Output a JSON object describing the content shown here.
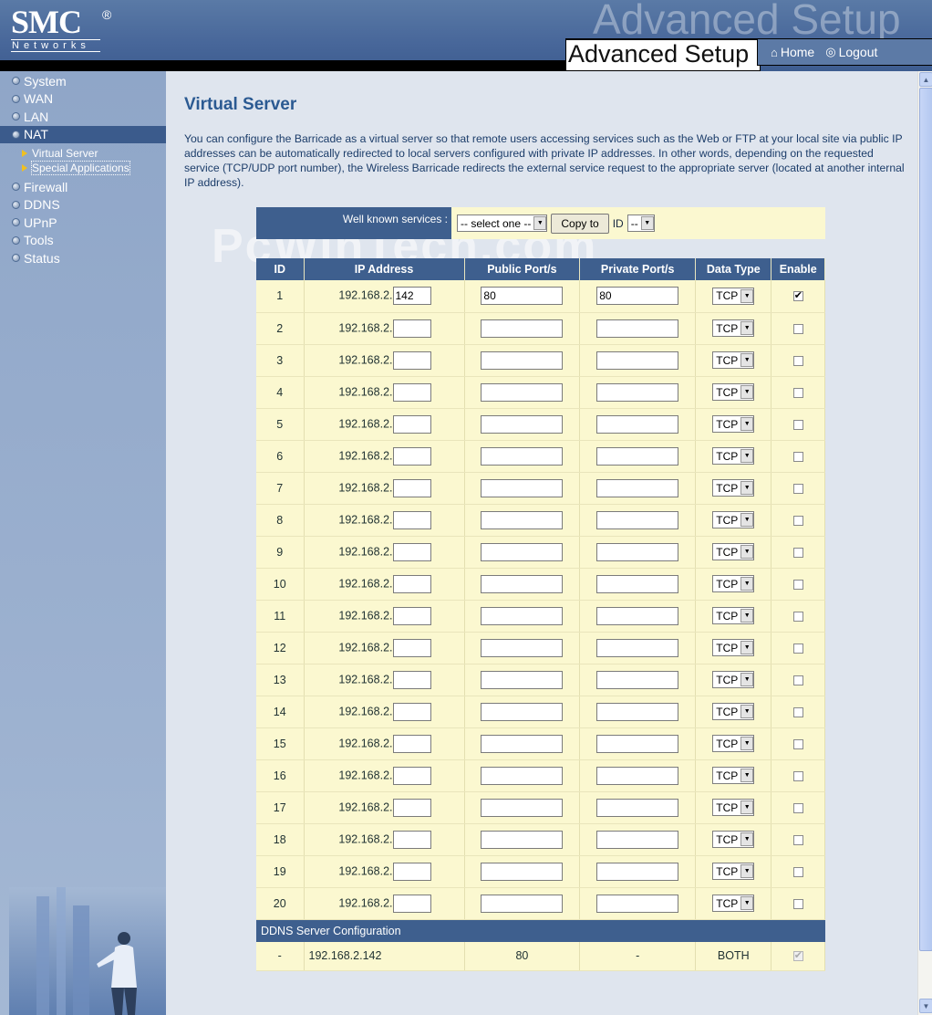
{
  "header": {
    "logo_text": "SMC",
    "logo_reg": "®",
    "logo_sub": "Networks",
    "ghost_title": "Advanced Setup",
    "title": "Advanced Setup",
    "home_label": "Home",
    "logout_label": "Logout"
  },
  "sidebar": {
    "items": [
      {
        "label": "System"
      },
      {
        "label": "WAN"
      },
      {
        "label": "LAN"
      },
      {
        "label": "NAT"
      },
      {
        "label": "Firewall"
      },
      {
        "label": "DDNS"
      },
      {
        "label": "UPnP"
      },
      {
        "label": "Tools"
      },
      {
        "label": "Status"
      }
    ],
    "sub_items": [
      {
        "label": "Virtual Server"
      },
      {
        "label": "Special Applications"
      }
    ]
  },
  "main": {
    "title": "Virtual Server",
    "intro": "You can configure the Barricade as a virtual server so that remote users accessing services such as the Web or FTP at your local site via public IP addresses can be automatically redirected to local servers configured with private IP addresses. In other words, depending on the requested service (TCP/UDP port number), the Wireless Barricade redirects the external service request to the appropriate server (located at another internal IP address).",
    "watermark": "PcWinTech.com",
    "well_known_label": "Well known services :",
    "service_select": "-- select one --",
    "copy_button": "Copy to",
    "id_label": "ID",
    "id_select": "--",
    "columns": [
      "ID",
      "IP Address",
      "Public Port/s",
      "Private Port/s",
      "Data Type",
      "Enable"
    ],
    "ip_prefix": "192.168.2.",
    "rows": [
      {
        "id": "1",
        "ip": "142",
        "public": "80",
        "private": "80",
        "type": "TCP",
        "enabled": true
      },
      {
        "id": "2",
        "ip": "",
        "public": "",
        "private": "",
        "type": "TCP",
        "enabled": false
      },
      {
        "id": "3",
        "ip": "",
        "public": "",
        "private": "",
        "type": "TCP",
        "enabled": false
      },
      {
        "id": "4",
        "ip": "",
        "public": "",
        "private": "",
        "type": "TCP",
        "enabled": false
      },
      {
        "id": "5",
        "ip": "",
        "public": "",
        "private": "",
        "type": "TCP",
        "enabled": false
      },
      {
        "id": "6",
        "ip": "",
        "public": "",
        "private": "",
        "type": "TCP",
        "enabled": false
      },
      {
        "id": "7",
        "ip": "",
        "public": "",
        "private": "",
        "type": "TCP",
        "enabled": false
      },
      {
        "id": "8",
        "ip": "",
        "public": "",
        "private": "",
        "type": "TCP",
        "enabled": false
      },
      {
        "id": "9",
        "ip": "",
        "public": "",
        "private": "",
        "type": "TCP",
        "enabled": false
      },
      {
        "id": "10",
        "ip": "",
        "public": "",
        "private": "",
        "type": "TCP",
        "enabled": false
      },
      {
        "id": "11",
        "ip": "",
        "public": "",
        "private": "",
        "type": "TCP",
        "enabled": false
      },
      {
        "id": "12",
        "ip": "",
        "public": "",
        "private": "",
        "type": "TCP",
        "enabled": false
      },
      {
        "id": "13",
        "ip": "",
        "public": "",
        "private": "",
        "type": "TCP",
        "enabled": false
      },
      {
        "id": "14",
        "ip": "",
        "public": "",
        "private": "",
        "type": "TCP",
        "enabled": false
      },
      {
        "id": "15",
        "ip": "",
        "public": "",
        "private": "",
        "type": "TCP",
        "enabled": false
      },
      {
        "id": "16",
        "ip": "",
        "public": "",
        "private": "",
        "type": "TCP",
        "enabled": false
      },
      {
        "id": "17",
        "ip": "",
        "public": "",
        "private": "",
        "type": "TCP",
        "enabled": false
      },
      {
        "id": "18",
        "ip": "",
        "public": "",
        "private": "",
        "type": "TCP",
        "enabled": false
      },
      {
        "id": "19",
        "ip": "",
        "public": "",
        "private": "",
        "type": "TCP",
        "enabled": false
      },
      {
        "id": "20",
        "ip": "",
        "public": "",
        "private": "",
        "type": "TCP",
        "enabled": false
      }
    ],
    "ddns": {
      "header": "DDNS Server Configuration",
      "id": "-",
      "ip": "192.168.2.142",
      "public": "80",
      "private": "-",
      "type": "BOTH",
      "enabled": true
    }
  },
  "colors": {
    "header_blue": "#48679a",
    "table_header": "#3e5f8e",
    "table_cell": "#fbf8d0",
    "title_blue": "#2b5a92"
  }
}
